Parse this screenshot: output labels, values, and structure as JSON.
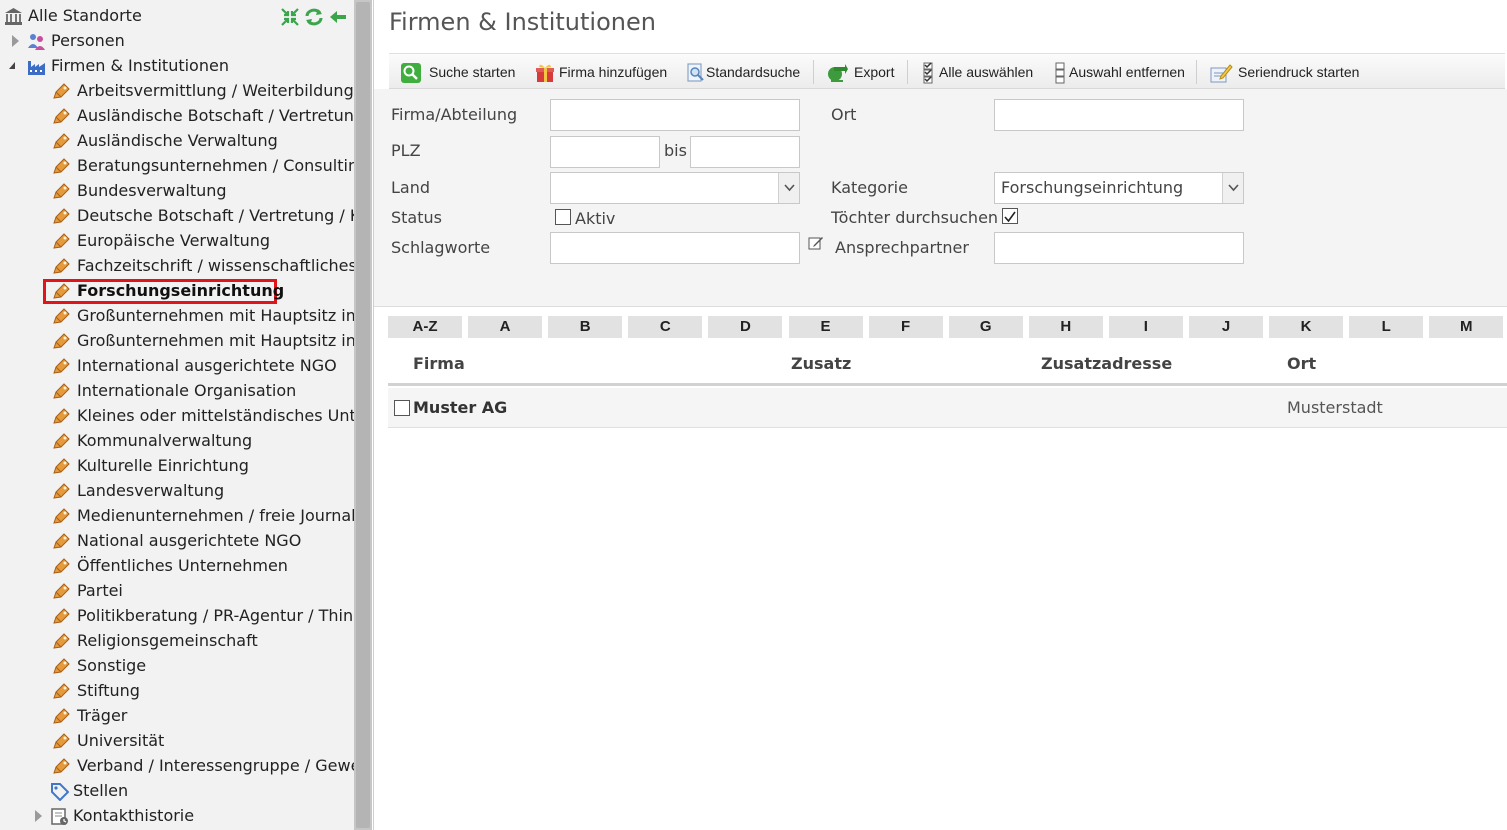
{
  "tree": {
    "root_label": "Alle Standorte",
    "personen_label": "Personen",
    "firmen_label": "Firmen & Institutionen",
    "categories": [
      "Arbeitsvermittlung / Weiterbildung / ",
      "Ausländische Botschaft / Vertretung",
      "Ausländische Verwaltung",
      "Beratungsunternehmen / Consulting",
      "Bundesverwaltung",
      "Deutsche Botschaft / Vertretung / Ku",
      "Europäische Verwaltung",
      "Fachzeitschrift / wissenschaftliches Jo",
      "Forschungseinrichtung",
      "Großunternehmen mit Hauptsitz im",
      "Großunternehmen mit Hauptsitz in D",
      "International ausgerichtete NGO",
      "Internationale Organisation",
      "Kleines oder mittelständisches Unter",
      "Kommunalverwaltung",
      "Kulturelle Einrichtung",
      "Landesverwaltung",
      "Medienunternehmen / freie Journalis",
      "National ausgerichtete NGO",
      "Öffentliches Unternehmen",
      "Partei",
      "Politikberatung / PR-Agentur / Think",
      "Religionsgemeinschaft",
      "Sonstige",
      "Stiftung",
      "Träger",
      "Universität",
      "Verband / Interessengruppe / Gewer"
    ],
    "selected_index": 8,
    "stellen_label": "Stellen",
    "kontakthistorie_label": "Kontakthistorie"
  },
  "main": {
    "title": "Firmen & Institutionen"
  },
  "toolbar": {
    "search": "Suche starten",
    "add": "Firma hinzufügen",
    "standard": "Standardsuche",
    "export": "Export",
    "select_all": "Alle auswählen",
    "deselect": "Auswahl entfernen",
    "mailmerge": "Seriendruck starten"
  },
  "form": {
    "firma_label": "Firma/Abteilung",
    "firma_value": "",
    "ort_label": "Ort",
    "ort_value": "",
    "plz_label": "PLZ",
    "plz_from": "",
    "bis_label": "bis",
    "plz_to": "",
    "land_label": "Land",
    "land_value": "",
    "kategorie_label": "Kategorie",
    "kategorie_value": "Forschungseinrichtung",
    "status_label": "Status",
    "aktiv_label": "Aktiv",
    "aktiv_checked": false,
    "toechter_label": "Töchter durchsuchen",
    "toechter_checked": true,
    "schlagworte_label": "Schlagworte",
    "schlagworte_value": "",
    "ansprech_label": "Ansprechpartner",
    "ansprech_value": ""
  },
  "alphabet": [
    "A-Z",
    "A",
    "B",
    "C",
    "D",
    "E",
    "F",
    "G",
    "H",
    "I",
    "J",
    "K",
    "L",
    "M"
  ],
  "results": {
    "headers": {
      "firma": "Firma",
      "zusatz": "Zusatz",
      "zusatzadresse": "Zusatzadresse",
      "ort": "Ort"
    },
    "rows": [
      {
        "firma": "Muster AG",
        "zusatz": "",
        "zusatzadresse": "",
        "ort": "Musterstadt"
      }
    ]
  }
}
